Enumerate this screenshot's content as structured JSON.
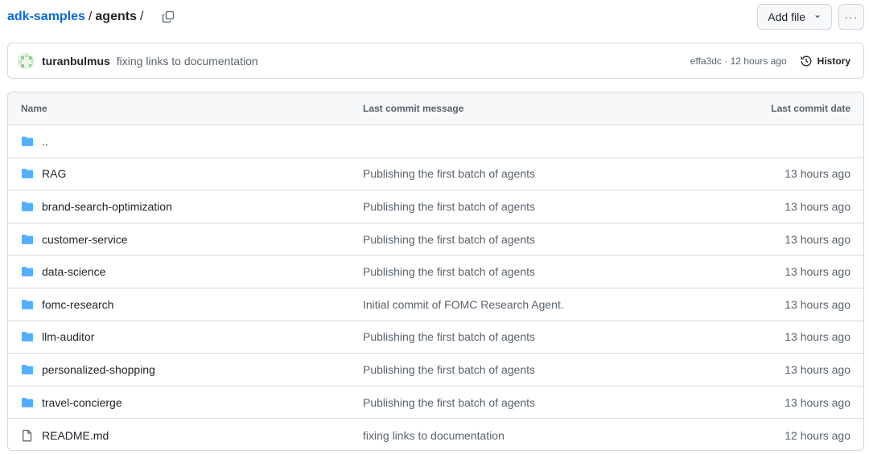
{
  "breadcrumb": {
    "repo": "adk-samples",
    "separator": "/",
    "folder": "agents",
    "trailing_separator": "/"
  },
  "toolbar": {
    "add_file_label": "Add file",
    "more_label": "···"
  },
  "latest_commit": {
    "author": "turanbulmus",
    "message": "fixing links to documentation",
    "meta": "effa3dc · 12 hours ago",
    "history_label": "History"
  },
  "table": {
    "headers": {
      "name": "Name",
      "message": "Last commit message",
      "date": "Last commit date"
    },
    "parent_label": "..",
    "rows": [
      {
        "name": "RAG",
        "type": "folder",
        "message": "Publishing the first batch of agents",
        "date": "13 hours ago"
      },
      {
        "name": "brand-search-optimization",
        "type": "folder",
        "message": "Publishing the first batch of agents",
        "date": "13 hours ago"
      },
      {
        "name": "customer-service",
        "type": "folder",
        "message": "Publishing the first batch of agents",
        "date": "13 hours ago"
      },
      {
        "name": "data-science",
        "type": "folder",
        "message": "Publishing the first batch of agents",
        "date": "13 hours ago"
      },
      {
        "name": "fomc-research",
        "type": "folder",
        "message": "Initial commit of FOMC Research Agent.",
        "date": "13 hours ago"
      },
      {
        "name": "llm-auditor",
        "type": "folder",
        "message": "Publishing the first batch of agents",
        "date": "13 hours ago"
      },
      {
        "name": "personalized-shopping",
        "type": "folder",
        "message": "Publishing the first batch of agents",
        "date": "13 hours ago"
      },
      {
        "name": "travel-concierge",
        "type": "folder",
        "message": "Publishing the first batch of agents",
        "date": "13 hours ago"
      },
      {
        "name": "README.md",
        "type": "file",
        "message": "fixing links to documentation",
        "date": "12 hours ago"
      }
    ]
  },
  "colors": {
    "link": "#0969da",
    "folder": "#54aeff",
    "muted": "#59636e",
    "border": "#d1d9e0"
  }
}
